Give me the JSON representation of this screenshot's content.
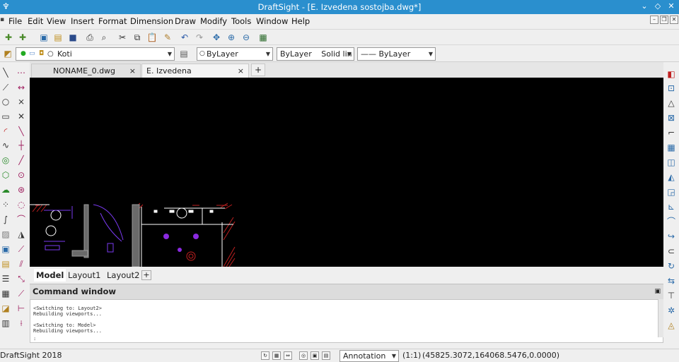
{
  "window": {
    "title": "DraftSight - [E. Izvedena sostojba.dwg*]"
  },
  "menu": [
    "File",
    "Edit",
    "View",
    "Insert",
    "Format",
    "Dimension",
    "Draw",
    "Modify",
    "Tools",
    "Window",
    "Help"
  ],
  "layer_toolbar": {
    "layer_name": "Koti",
    "color": "ByLayer",
    "linetype_combo": "ByLayer",
    "linetype_style": "Solid lin",
    "lineweight": "—— ByLayer"
  },
  "doc_tabs": [
    {
      "label": "NONAME_0.dwg",
      "close": "×"
    },
    {
      "label": "E. Izvedena sostojba.dwg*",
      "close": "×"
    }
  ],
  "doc_tab_add": "+",
  "layout_tabs": [
    "Model",
    "Layout1",
    "Layout2"
  ],
  "layout_add": "+",
  "command_window": {
    "title": "Command window",
    "lines": [
      "<Switching to: Layout2>",
      "Rebuilding viewports...",
      "",
      "<Switching to: Model>",
      "Rebuilding viewports...",
      ":"
    ]
  },
  "status": {
    "app": "DraftSight 2018",
    "annotation": "Annotation",
    "scale": "(1:1)",
    "coords": "(45825.3072,164068.5476,0.0000)"
  },
  "colors": {
    "titlebar": "#2a8fce",
    "canvas": "#000000"
  }
}
